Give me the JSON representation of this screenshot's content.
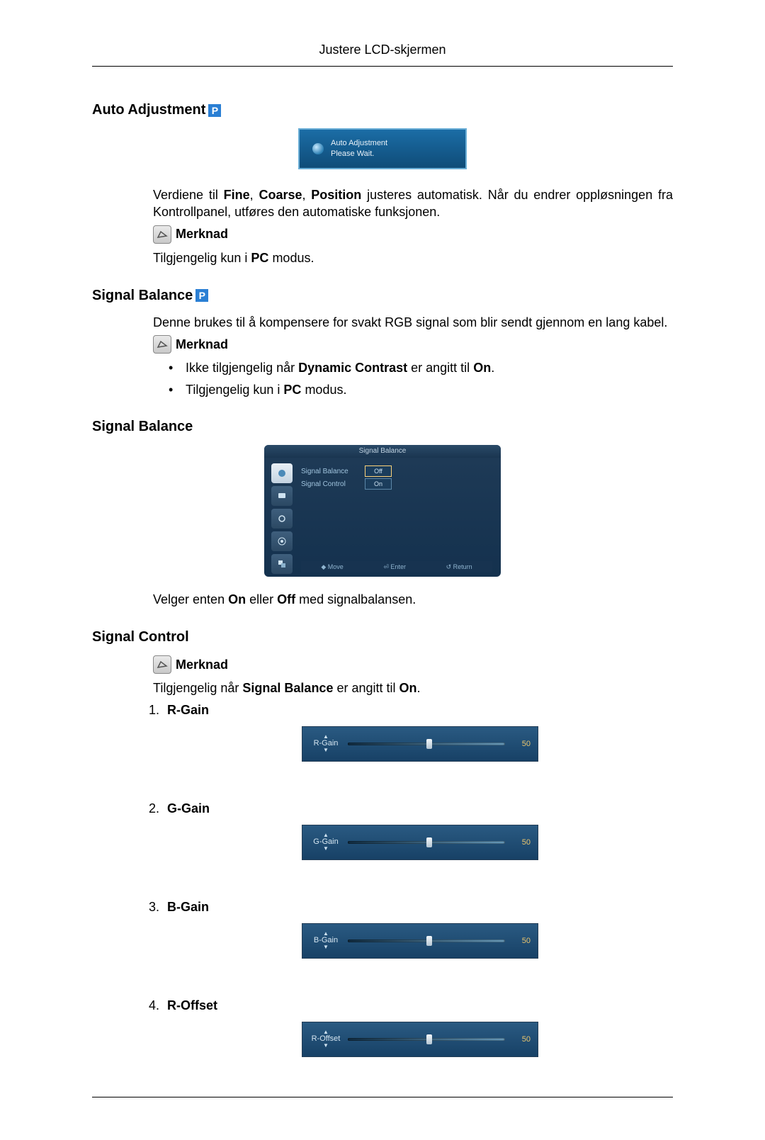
{
  "header": {
    "title": "Justere LCD-skjermen"
  },
  "p_badge": "P",
  "sections": {
    "auto_adjustment": {
      "title": "Auto Adjustment",
      "popup_line1": "Auto Adjustment",
      "popup_line2": "Please Wait.",
      "desc_prefix": "Verdiene til ",
      "fine": "Fine",
      "comma1": ", ",
      "coarse": "Coarse",
      "comma2": ", ",
      "position": "Position",
      "desc_suffix": " justeres automatisk. Når du endrer oppløsningen fra Kontrollpanel, utføres den automatiske funksjonen.",
      "note_label": "Merknad",
      "note_text_prefix": "Tilgjengelig kun i ",
      "pc": "PC",
      "note_text_suffix": " modus."
    },
    "signal_balance_intro": {
      "title": "Signal Balance",
      "desc": "Denne brukes til å kompensere for svakt RGB signal som blir sendt gjennom en lang kabel.",
      "note_label": "Merknad",
      "bullets": [
        {
          "prefix": "Ikke tilgjengelig når ",
          "bold": "Dynamic Contrast",
          "mid": " er angitt til ",
          "bold2": "On",
          "suffix": "."
        },
        {
          "prefix": "Tilgjengelig kun i ",
          "bold": "PC",
          "mid": " modus.",
          "bold2": "",
          "suffix": ""
        }
      ]
    },
    "signal_balance_panel": {
      "title": "Signal Balance",
      "osd_title": "Signal Balance",
      "rows": [
        {
          "label": "Signal Balance",
          "opt_off": "Off",
          "opt_on": "",
          "sel": "off"
        },
        {
          "label": "Signal Control",
          "opt_off": "",
          "opt_on": "On",
          "sel": "on"
        }
      ],
      "bottom": {
        "move": "◆ Move",
        "enter": "⏎ Enter",
        "return": "↺ Return"
      },
      "post_text_prefix": "Velger enten ",
      "on": "On",
      "mid": " eller ",
      "off": "Off",
      "post_text_suffix": " med signalbalansen."
    },
    "signal_control": {
      "title": "Signal Control",
      "note_label": "Merknad",
      "note_prefix": "Tilgjengelig når ",
      "sb": "Signal Balance",
      "mid": " er angitt til ",
      "on": "On",
      "suffix": ".",
      "items": [
        {
          "name": "R-Gain",
          "value": 50
        },
        {
          "name": "G-Gain",
          "value": 50
        },
        {
          "name": "B-Gain",
          "value": 50
        },
        {
          "name": "R-Offset",
          "value": 50
        }
      ]
    }
  }
}
